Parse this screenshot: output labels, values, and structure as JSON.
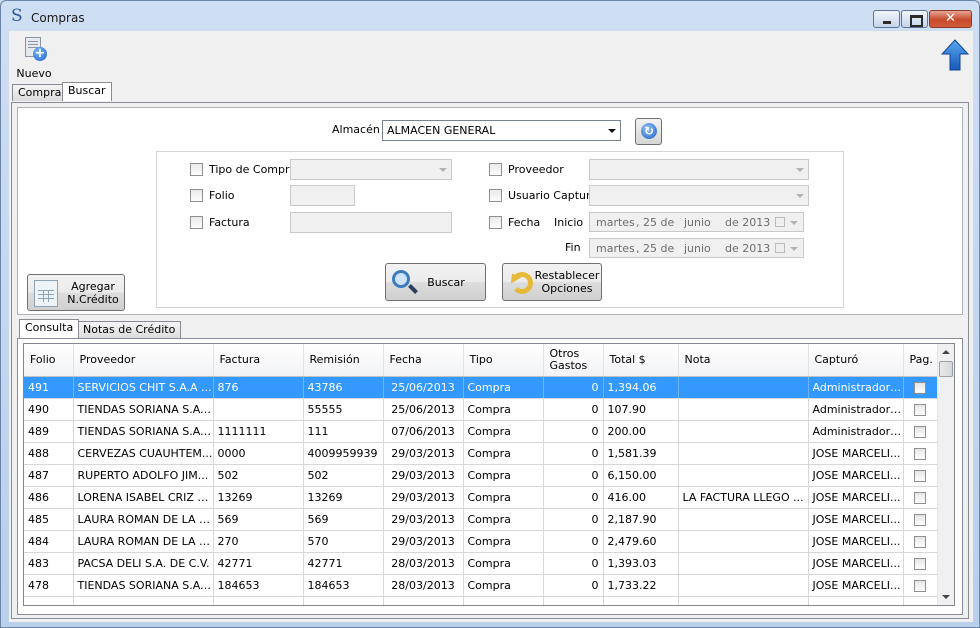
{
  "window": {
    "title": "Compras",
    "app_icon": "S"
  },
  "toolbar": {
    "nuevo_label": "Nuevo"
  },
  "main_tabs": [
    {
      "label": "Compra",
      "selected": false
    },
    {
      "label": "Buscar",
      "selected": true
    }
  ],
  "filters": {
    "almacen_label": "Almacén",
    "almacen_value": "ALMACEN GENERAL",
    "tipo_compra_label": "Tipo de Compra",
    "folio_label": "Folio",
    "factura_label": "Factura",
    "proveedor_label": "Proveedor",
    "usuario_label": "Usuario Capturó",
    "fecha_label": "Fecha",
    "inicio_label": "Inicio",
    "fin_label": "Fin",
    "inicio_date": {
      "day_name": "martes",
      "day": ", 25 de",
      "month": "junio",
      "year": "de 2013"
    },
    "fin_date": {
      "day_name": "martes",
      "day": ", 25 de",
      "month": "junio",
      "year": "de 2013"
    }
  },
  "buttons": {
    "agregar_line1": "Agregar",
    "agregar_line2": "N.Crédito",
    "buscar": "Buscar",
    "restablecer_line1": "Restablecer",
    "restablecer_line2": "Opciones"
  },
  "result_tabs": [
    {
      "label": "Consulta",
      "selected": true
    },
    {
      "label": "Notas de Crédito",
      "selected": false
    }
  ],
  "grid": {
    "columns": [
      "Folio",
      "Proveedor",
      "Factura",
      "Remisión",
      "Fecha",
      "Tipo",
      "Otros Gastos",
      "Total $",
      "Nota",
      "Capturó",
      "Pag."
    ],
    "rows": [
      {
        "folio": "491",
        "proveedor": "SERVICIOS CHIT S.A.A ...",
        "factura": "876",
        "remision": "43786",
        "fecha": "25/06/2013",
        "tipo": "Compra",
        "otros": "0",
        "total": "1,394.06",
        "nota": "",
        "capturo": "Administrador Sy...",
        "selected": true
      },
      {
        "folio": "490",
        "proveedor": "TIENDAS SORIANA S.A....",
        "factura": "",
        "remision": "55555",
        "fecha": "25/06/2013",
        "tipo": "Compra",
        "otros": "0",
        "total": "107.90",
        "nota": "",
        "capturo": "Administrador Sy..."
      },
      {
        "folio": "489",
        "proveedor": "TIENDAS SORIANA S.A....",
        "factura": "1111111",
        "remision": "111",
        "fecha": "07/06/2013",
        "tipo": "Compra",
        "otros": "0",
        "total": "200.00",
        "nota": "",
        "capturo": "Administrador Sy..."
      },
      {
        "folio": "488",
        "proveedor": "CERVEZAS CUAUHTEM...",
        "factura": "0000",
        "remision": "4009959939",
        "fecha": "29/03/2013",
        "tipo": "Compra",
        "otros": "0",
        "total": "1,581.39",
        "nota": "",
        "capturo": "JOSE MARCELI..."
      },
      {
        "folio": "487",
        "proveedor": "RUPERTO ADOLFO JIM...",
        "factura": "502",
        "remision": "502",
        "fecha": "29/03/2013",
        "tipo": "Compra",
        "otros": "0",
        "total": "6,150.00",
        "nota": "",
        "capturo": "JOSE MARCELI..."
      },
      {
        "folio": "486",
        "proveedor": "LORENA ISABEL CRIZ V...",
        "factura": "13269",
        "remision": "13269",
        "fecha": "29/03/2013",
        "tipo": "Compra",
        "otros": "0",
        "total": "416.00",
        "nota": "LA FACTURA LLEGO ...",
        "capturo": "JOSE MARCELI..."
      },
      {
        "folio": "485",
        "proveedor": "LAURA ROMAN DE LA C...",
        "factura": "569",
        "remision": "569",
        "fecha": "29/03/2013",
        "tipo": "Compra",
        "otros": "0",
        "total": "2,187.90",
        "nota": "",
        "capturo": "JOSE MARCELI..."
      },
      {
        "folio": "484",
        "proveedor": "LAURA ROMAN DE LA C...",
        "factura": "270",
        "remision": "570",
        "fecha": "29/03/2013",
        "tipo": "Compra",
        "otros": "0",
        "total": "2,479.60",
        "nota": "",
        "capturo": "JOSE MARCELI..."
      },
      {
        "folio": "483",
        "proveedor": "PACSA DELI S.A. DE C.V.",
        "factura": "42771",
        "remision": "42771",
        "fecha": "28/03/2013",
        "tipo": "Compra",
        "otros": "0",
        "total": "1,393.03",
        "nota": "",
        "capturo": "JOSE MARCELI..."
      },
      {
        "folio": "478",
        "proveedor": "TIENDAS SORIANA S.A....",
        "factura": "184653",
        "remision": "184653",
        "fecha": "28/03/2013",
        "tipo": "Compra",
        "otros": "0",
        "total": "1,733.22",
        "nota": "",
        "capturo": "JOSE MARCELI..."
      }
    ]
  },
  "colors": {
    "selection": "#3399ff",
    "accent": "#1e62c9"
  }
}
